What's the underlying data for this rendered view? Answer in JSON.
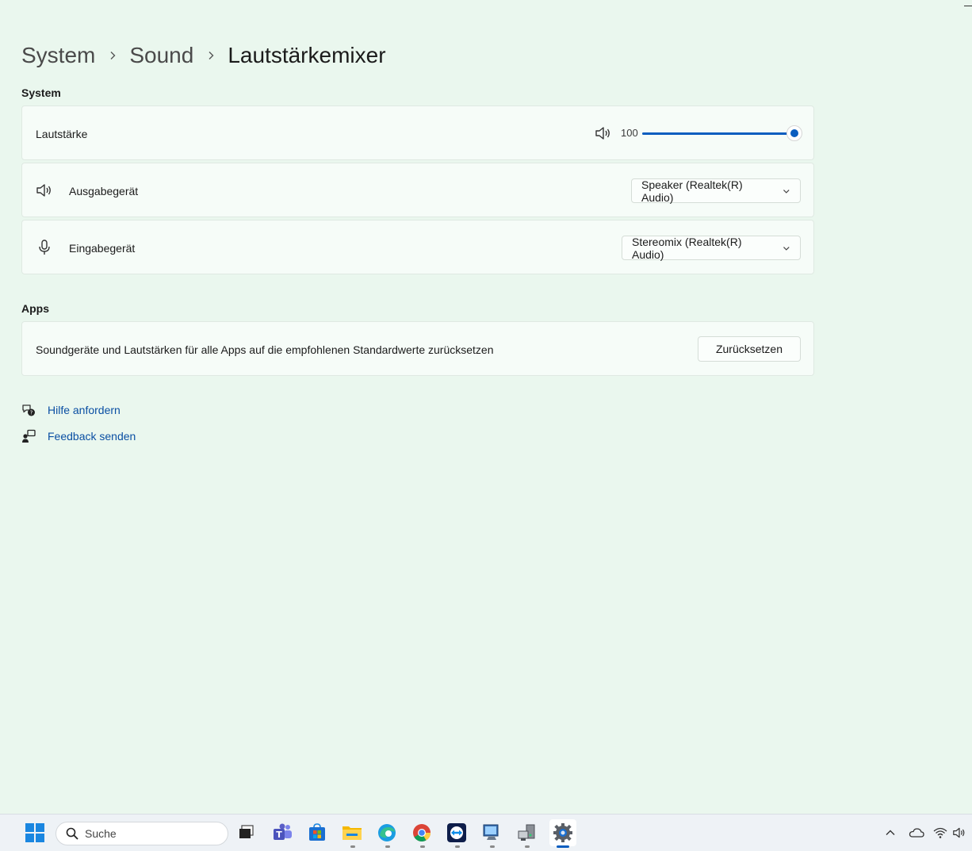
{
  "breadcrumb": {
    "items": [
      "System",
      "Sound"
    ],
    "current": "Lautstärkemixer"
  },
  "sections": {
    "system": "System",
    "apps": "Apps"
  },
  "volume": {
    "label": "Lautstärke",
    "value": "100",
    "level_percent": 100,
    "icon": "speaker-icon"
  },
  "output_device": {
    "label": "Ausgabegerät",
    "selected": "Speaker (Realtek(R) Audio)",
    "icon": "speaker-icon"
  },
  "input_device": {
    "label": "Eingabegerät",
    "selected": "Stereomix (Realtek(R) Audio)",
    "icon": "microphone-icon"
  },
  "apps_reset": {
    "description": "Soundgeräte und Lautstärken für alle Apps auf die empfohlenen Standardwerte zurücksetzen",
    "button_label": "Zurücksetzen"
  },
  "links": {
    "help": "Hilfe anfordern",
    "feedback": "Feedback senden"
  },
  "taskbar": {
    "search_placeholder": "Suche",
    "apps": [
      "start-icon",
      "task-view-icon",
      "teams-icon",
      "store-icon",
      "file-explorer-icon",
      "edge-icon",
      "chrome-icon",
      "teamviewer-icon",
      "remote-desktop-icon",
      "device-manager-icon",
      "settings-icon"
    ]
  },
  "colors": {
    "accent": "#0a5dbf",
    "background": "#eaf7ee",
    "card": "#f6fcf8",
    "link": "#0a4fa3"
  }
}
